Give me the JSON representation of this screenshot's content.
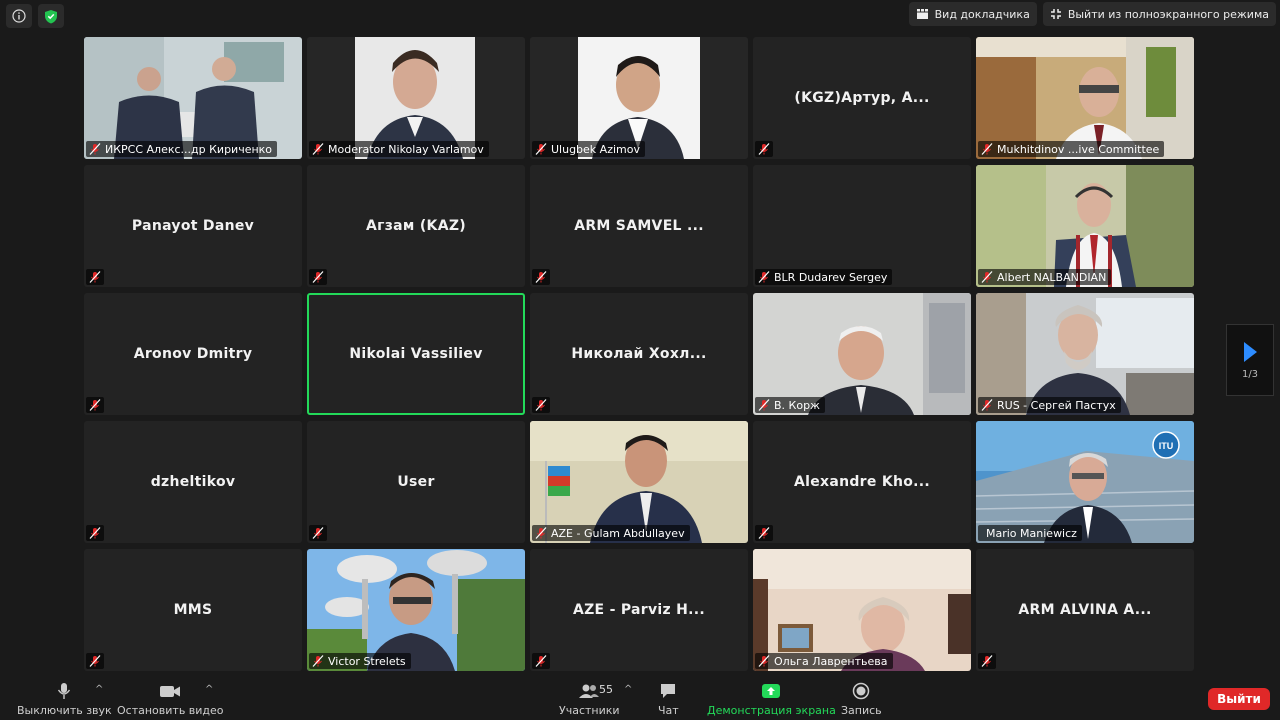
{
  "top_bar": {
    "speaker_view_label": "Вид докладчика",
    "exit_fullscreen_label": "Выйти из полноэкранного режима"
  },
  "tiles": [
    {
      "label": "ИКРСС Алекс...др Кириченко",
      "name": "",
      "video": true
    },
    {
      "label": "Moderator Nikolay Varlamov",
      "name": "",
      "video": true
    },
    {
      "label": "Ulugbek Azimov",
      "name": "",
      "video": true
    },
    {
      "label": "",
      "name": "(KGZ)Артур, А...",
      "video": false
    },
    {
      "label": "Mukhitdinov ...ive Committee",
      "name": "",
      "video": true
    },
    {
      "label": "",
      "name": "Panayot Danev",
      "video": false
    },
    {
      "label": "",
      "name": "Агзам (KAZ)",
      "video": false
    },
    {
      "label": "",
      "name": "ARM SAMVEL ...",
      "video": false
    },
    {
      "label": "BLR Dudarev Sergey",
      "name": "",
      "video": false
    },
    {
      "label": "Albert NALBANDIAN",
      "name": "",
      "video": true
    },
    {
      "label": "",
      "name": "Aronov Dmitry",
      "video": false
    },
    {
      "label": "",
      "name": "Nikolai Vassiliev",
      "video": false,
      "active": true
    },
    {
      "label": "",
      "name": "Николай Хохл...",
      "video": false
    },
    {
      "label": "В. Корж",
      "name": "",
      "video": true
    },
    {
      "label": "RUS - Сергей Пастух",
      "name": "",
      "video": true
    },
    {
      "label": "",
      "name": "dzheltikov",
      "video": false
    },
    {
      "label": "",
      "name": "User",
      "video": false
    },
    {
      "label": "AZE - Gulam Abdullayev",
      "name": "",
      "video": true
    },
    {
      "label": "",
      "name": "Alexandre Kho...",
      "video": false
    },
    {
      "label": "Mario Maniewicz",
      "name": "",
      "video": true,
      "unmuted": true
    },
    {
      "label": "",
      "name": "MMS",
      "video": false
    },
    {
      "label": "Victor Strelets",
      "name": "",
      "video": true
    },
    {
      "label": "",
      "name": "AZE - Parviz H...",
      "video": false
    },
    {
      "label": "Ольга Лаврентьева",
      "name": "",
      "video": true
    },
    {
      "label": "",
      "name": "ARM ALVINA A...",
      "video": false
    }
  ],
  "pager": {
    "page": "1/3"
  },
  "toolbar": {
    "mute_label": "Выключить звук",
    "video_label": "Остановить видео",
    "participants_label": "Участники",
    "participants_count": "55",
    "chat_label": "Чат",
    "share_label": "Демонстрация экрана",
    "record_label": "Запись",
    "leave_label": "Выйти"
  },
  "colors": {
    "active_speaker": "#23d959",
    "share_green": "#23d959",
    "leave_red": "#e02828",
    "mute_red": "#e02828"
  }
}
